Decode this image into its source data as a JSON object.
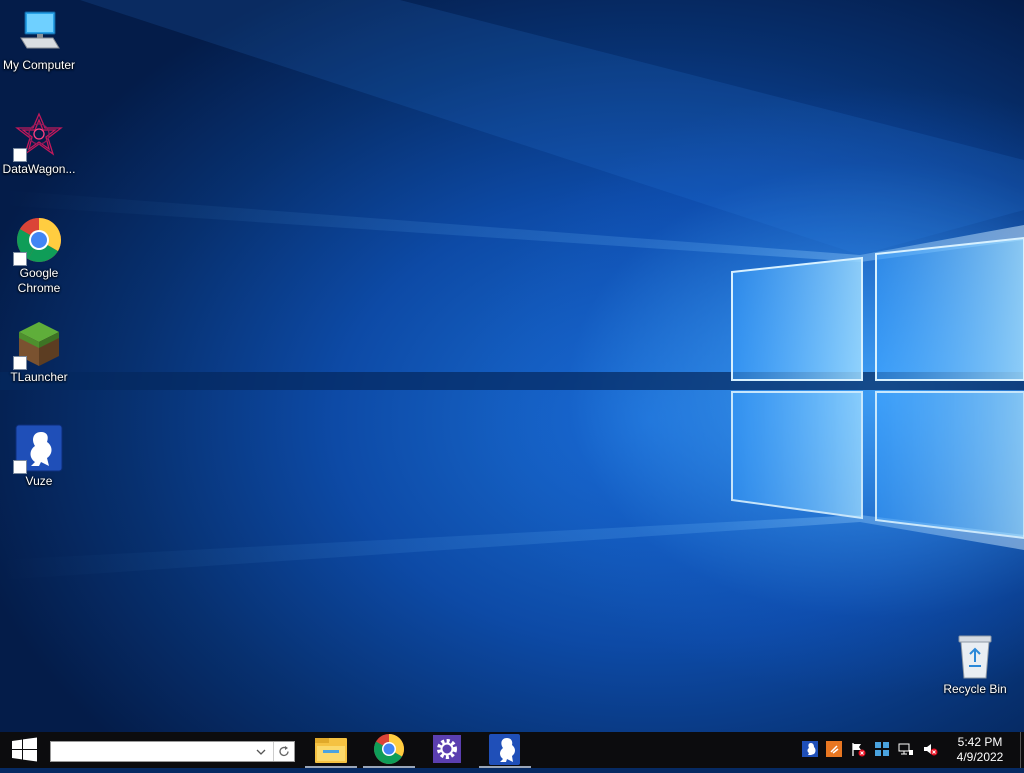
{
  "desktop": {
    "icons": [
      {
        "label": "My Computer",
        "icon": "computer-icon"
      },
      {
        "label": "DataWagon...",
        "icon": "datawagon-icon"
      },
      {
        "label": "Google Chrome",
        "icon": "chrome-icon"
      },
      {
        "label": "TLauncher",
        "icon": "tlauncher-icon"
      },
      {
        "label": "Vuze",
        "icon": "vuze-icon"
      },
      {
        "label": "Recycle Bin",
        "icon": "recycle-bin-icon"
      }
    ]
  },
  "taskbar": {
    "search": {
      "value": "",
      "placeholder": ""
    },
    "pinned_apps": [
      {
        "name": "File Explorer",
        "icon": "folder-icon"
      },
      {
        "name": "Google Chrome",
        "icon": "chrome-icon"
      },
      {
        "name": "Settings",
        "icon": "gear-icon"
      },
      {
        "name": "Vuze",
        "icon": "vuze-icon"
      }
    ],
    "tray_icons": [
      "vuze-tray-icon",
      "java-update-icon",
      "action-center-flag-icon",
      "windows-defender-icon",
      "network-icon",
      "volume-muted-icon"
    ],
    "clock": {
      "time": "5:42 PM",
      "date": "4/9/2022"
    }
  },
  "colors": {
    "taskbar": "#0c0c0e",
    "wallpaper_accent": "#1a6fd6",
    "vuze_blue": "#1f4fb8"
  }
}
